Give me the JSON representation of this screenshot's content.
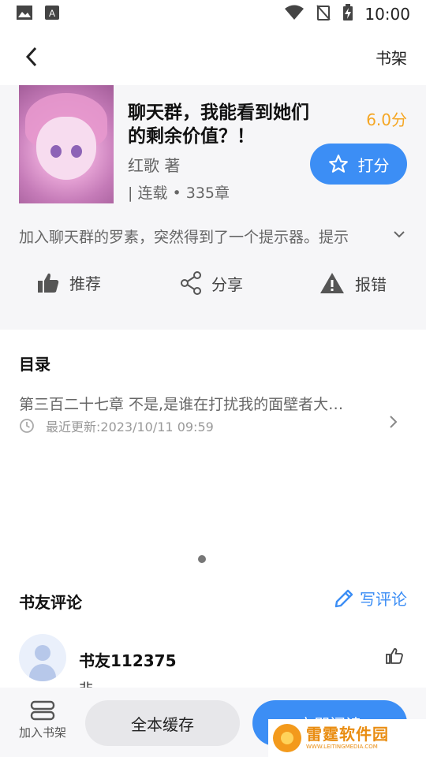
{
  "status_bar": {
    "time": "10:00"
  },
  "topbar": {
    "shelf_label": "书架"
  },
  "book": {
    "title": "聊天群，我能看到她们的剩余价值？！",
    "score": "6.0分",
    "author": "红歌 著",
    "meta": "| 连载 • 335章",
    "rate_label": "打分",
    "synopsis": "加入聊天群的罗素，突然得到了一个提示器。提示"
  },
  "actions": [
    {
      "label": "推荐",
      "icon": "thumbs-up-icon"
    },
    {
      "label": "分享",
      "icon": "share-icon"
    },
    {
      "label": "报错",
      "icon": "warning-icon"
    }
  ],
  "toc": {
    "title": "目录",
    "latest_chapter": "第三百二十七章 不是,是谁在打扰我的面壁者大…",
    "last_update": "最近更新:2023/10/11 09:59"
  },
  "comments": {
    "title": "书友评论",
    "write_label": "写评论",
    "items": [
      {
        "user": "书友112375",
        "text": "非"
      }
    ]
  },
  "bottom_bar": {
    "add_shelf_label": "加入书架",
    "cache_label": "全本缓存",
    "read_label": "立即阅读"
  },
  "watermark": {
    "cn": "雷霆软件园",
    "en": "WWW.LEITINGMEDIA.COM"
  },
  "colors": {
    "accent": "#3c8ef5",
    "score": "#f5a623",
    "section_bg": "#f6f6f8"
  }
}
